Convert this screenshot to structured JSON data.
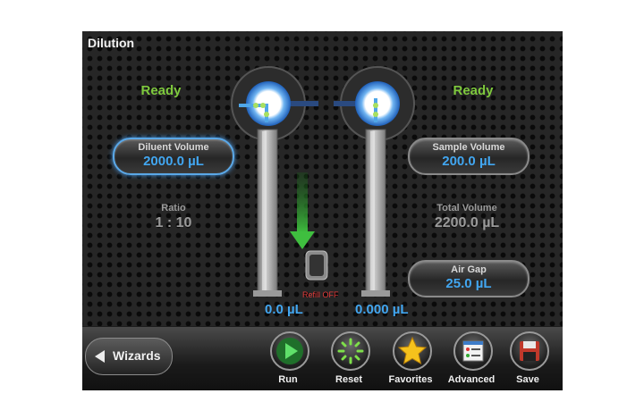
{
  "window": {
    "title": "Dilution"
  },
  "left": {
    "status": "Ready",
    "diluent_volume": {
      "label": "Diluent Volume",
      "value": "2000.0 µL"
    },
    "ratio": {
      "label": "Ratio",
      "value": "1 : 10"
    },
    "syringe_volume": "0.0 µL"
  },
  "right": {
    "status": "Ready",
    "sample_volume": {
      "label": "Sample Volume",
      "value": "200.0 µL"
    },
    "total_volume": {
      "label": "Total Volume",
      "value": "2200.0 µL"
    },
    "air_gap": {
      "label": "Air Gap",
      "value": "25.0 µL"
    },
    "syringe_volume": "0.000 µL"
  },
  "refill": {
    "label": "Refill OFF"
  },
  "toolbar": {
    "wizards_label": "Wizards",
    "run_label": "Run",
    "reset_label": "Reset",
    "favorites_label": "Favorites",
    "advanced_label": "Advanced",
    "save_label": "Save"
  },
  "colors": {
    "ready": "#7ec93d",
    "value_blue": "#42a6f0",
    "arrow_green": "#3fbf3f",
    "refill_red": "#e23b3b"
  },
  "icons": [
    "play-icon",
    "reset-icon",
    "star-icon",
    "advanced-icon",
    "floppy-disk-icon",
    "back-arrow-icon"
  ]
}
